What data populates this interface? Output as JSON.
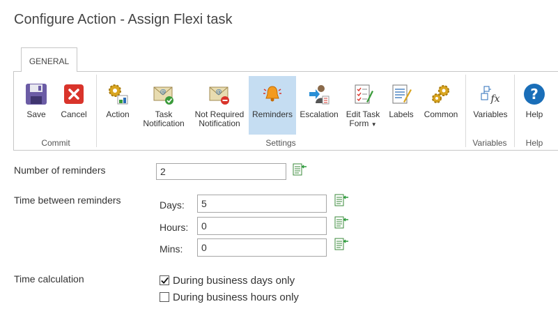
{
  "header": {
    "title": "Configure Action - Assign Flexi task"
  },
  "tab": {
    "label": "GENERAL"
  },
  "ribbon": {
    "buttons": {
      "save": "Save",
      "cancel": "Cancel",
      "action": "Action",
      "task_notification_1": "Task",
      "task_notification_2": "Notification",
      "not_required_1": "Not Required",
      "not_required_2": "Notification",
      "reminders": "Reminders",
      "escalation": "Escalation",
      "edit_task_form_1": "Edit Task",
      "edit_task_form_2": "Form",
      "labels": "Labels",
      "common": "Common",
      "variables": "Variables",
      "help": "Help"
    },
    "groups": {
      "commit": "Commit",
      "settings": "Settings",
      "variables": "Variables",
      "help": "Help"
    },
    "active": "reminders"
  },
  "form": {
    "number_of_reminders": {
      "label": "Number of reminders",
      "value": "2"
    },
    "time_between": {
      "label": "Time between reminders",
      "days_label": "Days:",
      "days_value": "5",
      "hours_label": "Hours:",
      "hours_value": "0",
      "mins_label": "Mins:",
      "mins_value": "0"
    },
    "time_calculation": {
      "label": "Time calculation",
      "option1": {
        "label": "During business days only",
        "checked": true
      },
      "option2": {
        "label": "During business hours only",
        "checked": false
      }
    }
  },
  "icons": [
    "save-icon",
    "cancel-icon",
    "action-gear-icon",
    "task-notification-icon",
    "not-required-notification-icon",
    "bell-icon",
    "escalation-icon",
    "edit-form-icon",
    "labels-icon",
    "common-gears-icon",
    "variables-fx-icon",
    "help-icon",
    "insert-reference-icon",
    "checkmark-icon"
  ],
  "colors": {
    "active_button": "#c5ddf2",
    "help_blue": "#1a6eb8",
    "cancel_red": "#d9342b",
    "save_purple": "#6b5ca5"
  }
}
